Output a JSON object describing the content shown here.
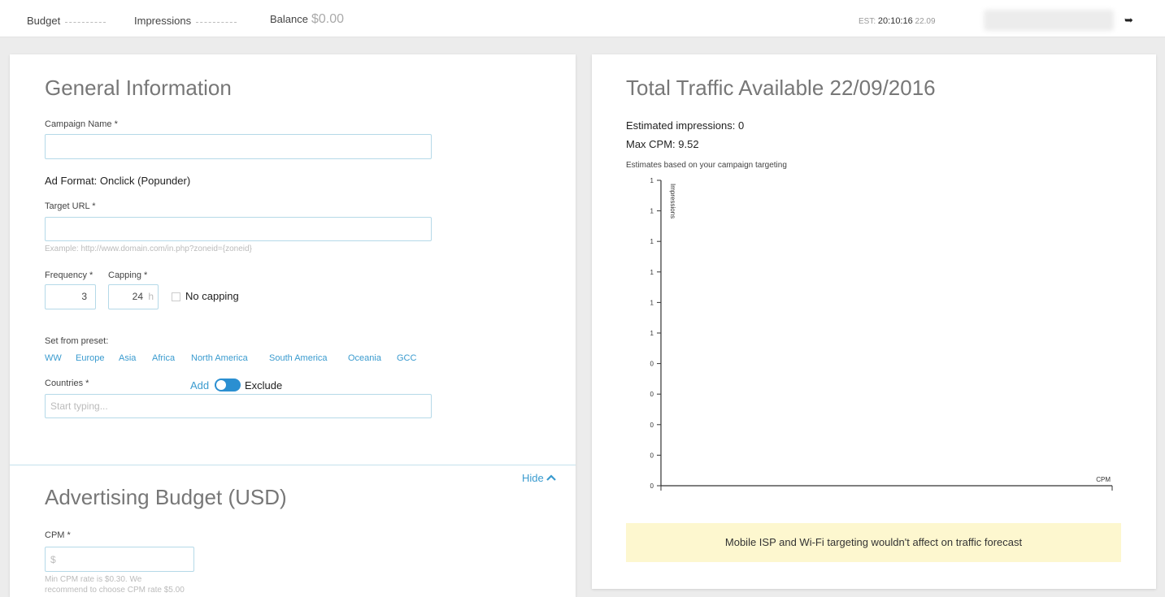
{
  "topbar": {
    "budget_label": "Budget",
    "impressions_label": "Impressions",
    "balance_label": "Balance",
    "balance_value": "$0.00",
    "est_label": "EST:",
    "time": "20:10:16",
    "date": "22.09",
    "logout_icon": "logout-icon"
  },
  "general": {
    "title": "General Information",
    "campaign_name_label": "Campaign Name *",
    "campaign_name_value": "",
    "ad_format": "Ad Format: Onclick (Popunder)",
    "target_url_label": "Target URL *",
    "target_url_value": "",
    "target_url_example": "Example: http://www.domain.com/in.php?zoneid={zoneid}",
    "frequency_label": "Frequency *",
    "capping_label": "Capping *",
    "frequency_value": "3",
    "capping_value": "24",
    "capping_unit": "h",
    "no_capping_label": "No capping",
    "preset_label": "Set from preset:",
    "presets": [
      "WW",
      "Europe",
      "Asia",
      "Africa",
      "North America",
      "South America",
      "Oceania",
      "GCC"
    ],
    "countries_label": "Countries *",
    "add_label": "Add",
    "exclude_label": "Exclude",
    "countries_placeholder": "Start typing..."
  },
  "budget": {
    "hide_label": "Hide",
    "title": "Advertising Budget (USD)",
    "cpm_label": "CPM *",
    "cpm_placeholder": "$",
    "cpm_hint_1": "Min CPM rate is $0.30. We",
    "cpm_hint_2": "recommend to choose CPM rate $5.00"
  },
  "traffic": {
    "title": "Total Traffic Available 22/09/2016",
    "estimated_impressions": "Estimated impressions: 0",
    "max_cpm": "Max CPM: 9.52",
    "estimates_note": "Estimates based on your campaign targeting",
    "notice": "Mobile ISP and Wi-Fi targeting wouldn't affect on traffic forecast"
  },
  "chart_data": {
    "type": "line",
    "ylabel": "Impressions",
    "xlabel": "CPM",
    "y_tick_labels": [
      "1",
      "1",
      "1",
      "1",
      "1",
      "1",
      "0",
      "0",
      "0",
      "0",
      "0"
    ],
    "series": []
  }
}
